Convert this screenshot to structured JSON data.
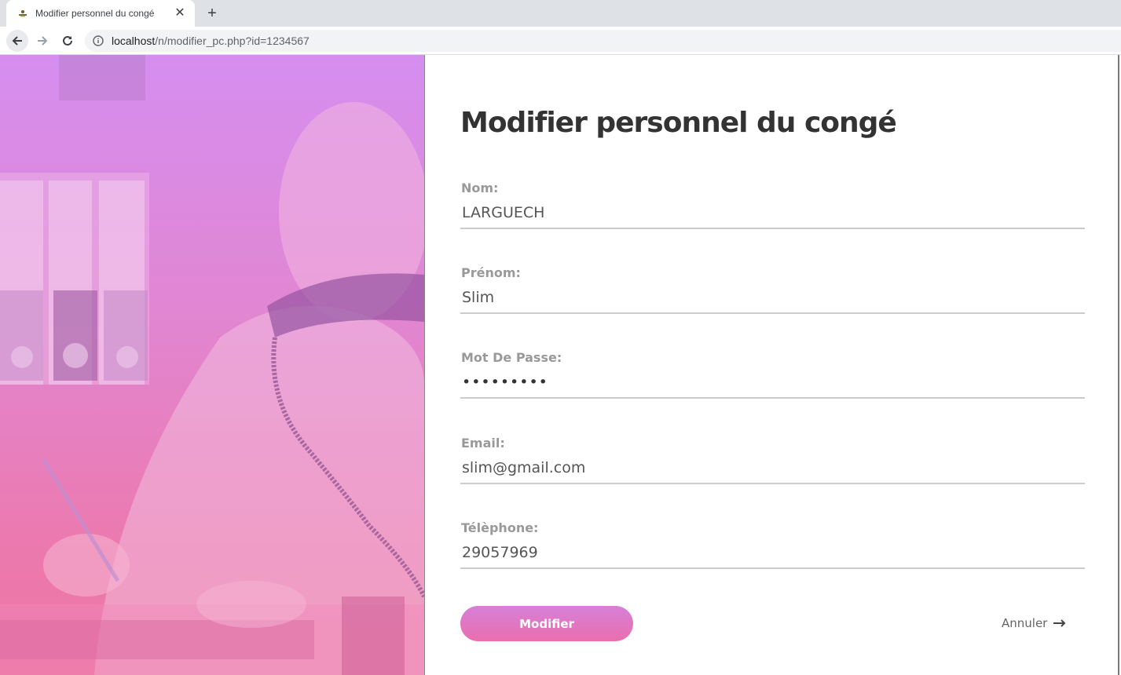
{
  "browser": {
    "tab_title": "Modifier personnel du congé",
    "tab_close": "✕",
    "new_tab": "+",
    "url_host": "localhost",
    "url_path": "/n/modifier_pc.php?id=1234567"
  },
  "form": {
    "title": "Modifier personnel du congé",
    "fields": [
      {
        "label": "Nom:",
        "value": "LARGUECH"
      },
      {
        "label": "Prénom:",
        "value": "Slim"
      },
      {
        "label": "Mot De Passe:",
        "value": "•••••••••"
      },
      {
        "label": "Email:",
        "value": "slim@gmail.com"
      },
      {
        "label": "Télèphone:",
        "value": "29057969"
      }
    ],
    "submit_label": "Modifier",
    "cancel_label": "Annuler"
  },
  "colors": {
    "gradient_top": "#d58ef0",
    "gradient_bottom": "#ee76a3",
    "button_top": "#d67fd8",
    "button_bottom": "#ea6fae"
  }
}
